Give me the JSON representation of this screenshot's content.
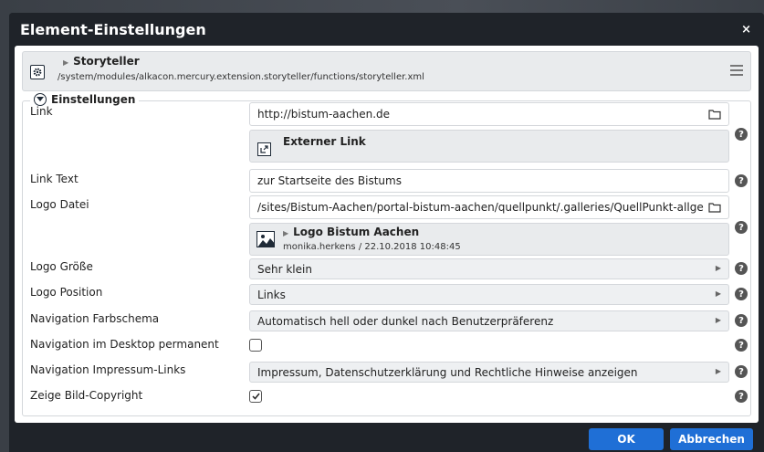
{
  "dialog": {
    "title": "Element-Einstellungen",
    "close_glyph": "×"
  },
  "header": {
    "title": "Storyteller",
    "path": "/system/modules/alkacon.mercury.extension.storyteller/functions/storyteller.xml"
  },
  "section": {
    "title": "Einstellungen"
  },
  "fields": {
    "link": {
      "label": "Link",
      "value": "http://bistum-aachen.de",
      "preview_title": "Externer Link"
    },
    "link_text": {
      "label": "Link Text",
      "value": "zur Startseite des Bistums"
    },
    "logo_file": {
      "label": "Logo Datei",
      "value": "/sites/Bistum-Aachen/portal-bistum-aachen/quellpunkt/.galleries/QuellPunkt-allge",
      "preview_title": "Logo Bistum Aachen",
      "preview_meta": "monika.herkens / 22.10.2018 10:48:45"
    },
    "logo_size": {
      "label": "Logo Größe",
      "value": "Sehr klein"
    },
    "logo_position": {
      "label": "Logo Position",
      "value": "Links"
    },
    "nav_color": {
      "label": "Navigation Farbschema",
      "value": "Automatisch hell oder dunkel nach Benutzerpräferenz"
    },
    "nav_desktop": {
      "label": "Navigation im Desktop permanent",
      "checked": false
    },
    "nav_legal": {
      "label": "Navigation Impressum-Links",
      "value": "Impressum, Datenschutzerklärung und Rechtliche Hinweise anzeigen"
    },
    "copyright": {
      "label": "Zeige Bild-Copyright",
      "checked": true
    }
  },
  "buttons": {
    "ok": "OK",
    "cancel": "Abbrechen"
  },
  "colors": {
    "primary": "#1f6fd6",
    "titlebar": "#1f2329"
  }
}
